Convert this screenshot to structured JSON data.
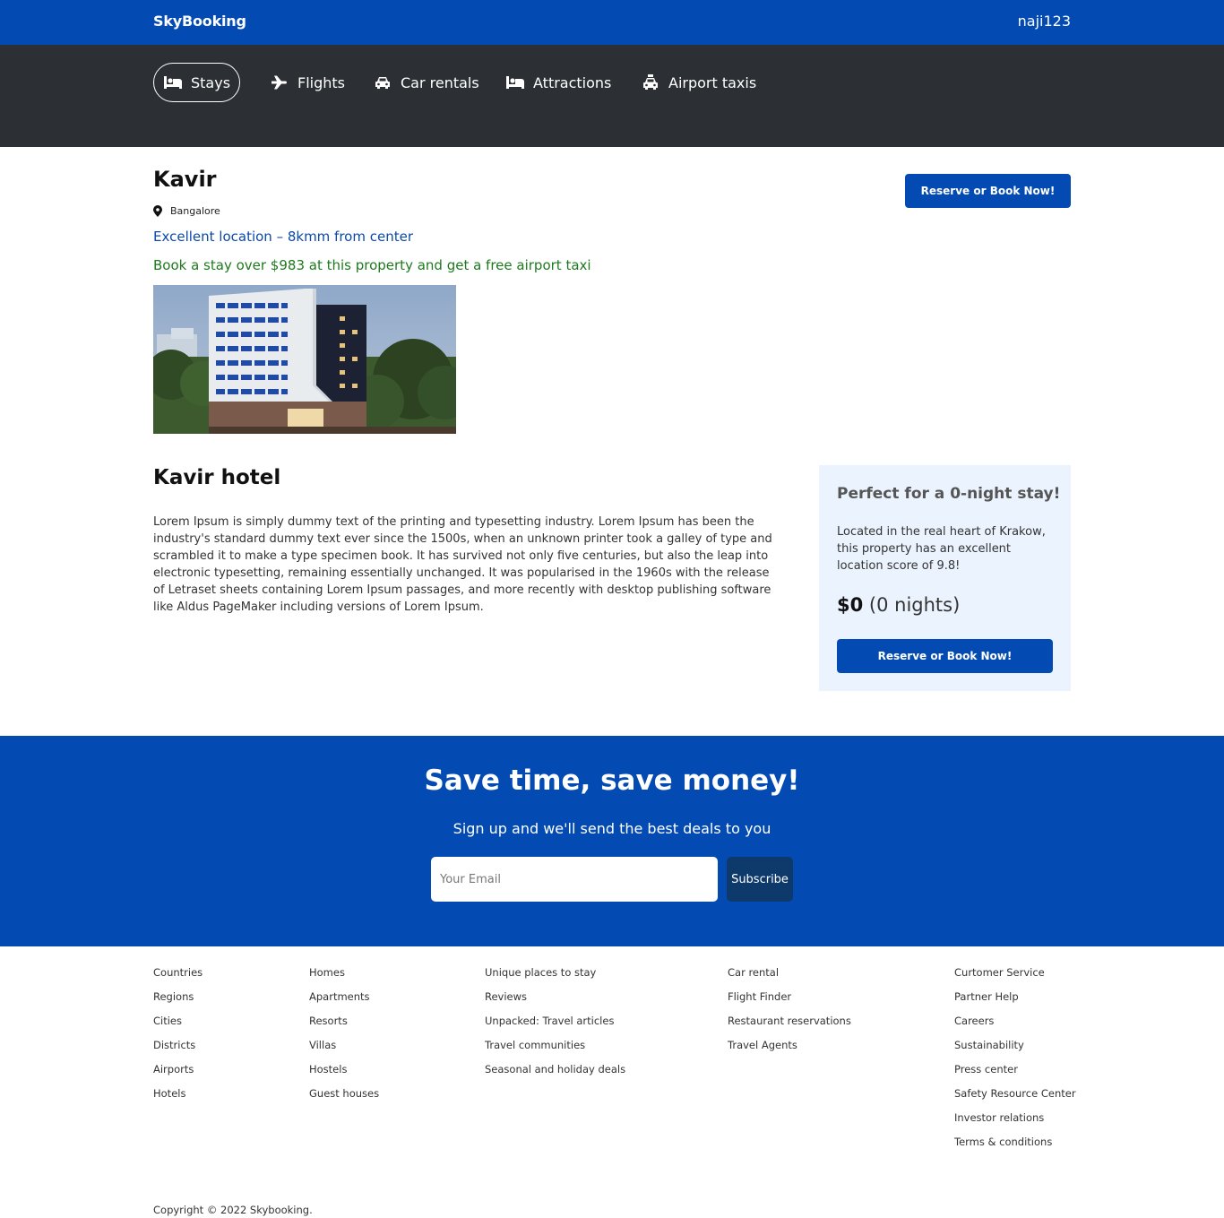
{
  "header": {
    "brand": "SkyBooking",
    "username": "naji123"
  },
  "nav": [
    {
      "label": "Stays",
      "icon": "bed-icon",
      "active": true
    },
    {
      "label": "Flights",
      "icon": "plane-icon",
      "active": false
    },
    {
      "label": "Car rentals",
      "icon": "car-icon",
      "active": false
    },
    {
      "label": "Attractions",
      "icon": "bed-icon",
      "active": false
    },
    {
      "label": "Airport taxis",
      "icon": "taxi-icon",
      "active": false
    }
  ],
  "hotel": {
    "name": "Kavir",
    "city": "Bangalore",
    "location_text": "Excellent location – 8kmm from center",
    "promo": "Book a stay over $983 at this property and get a free airport taxi",
    "reserve_label": "Reserve or Book Now!",
    "desc_title": "Kavir hotel",
    "description": "Lorem Ipsum is simply dummy text of the printing and typesetting industry. Lorem Ipsum has been the industry's standard dummy text ever since the 1500s, when an unknown printer took a galley of type and scrambled it to make a type specimen book. It has survived not only five centuries, but also the leap into electronic typesetting, remaining essentially unchanged. It was popularised in the 1960s with the release of Letraset sheets containing Lorem Ipsum passages, and more recently with desktop publishing software like Aldus PageMaker including versions of Lorem Ipsum."
  },
  "sidebox": {
    "title": "Perfect for a 0-night stay!",
    "text": "Located in the real heart of Krakow, this property has an excellent location score of 9.8!",
    "price": "$0",
    "nights": "(0 nights)",
    "reserve_label": "Reserve or Book Now!"
  },
  "newsletter": {
    "title": "Save time, save money!",
    "subtitle": "Sign up and we'll send the best deals to you",
    "email_placeholder": "Your Email",
    "email_value": "",
    "subscribe_label": "Subscribe"
  },
  "footer": {
    "col1": [
      "Countries",
      "Regions",
      "Cities",
      "Districts",
      "Airports",
      "Hotels"
    ],
    "col2": [
      "Homes",
      "Apartments",
      "Resorts",
      "Villas",
      "Hostels",
      "Guest houses"
    ],
    "col3": [
      "Unique places to stay",
      "Reviews",
      "Unpacked: Travel articles",
      "Travel communities",
      "Seasonal and holiday deals"
    ],
    "col4": [
      "Car rental",
      "Flight Finder",
      "Restaurant reservations",
      "Travel Agents"
    ],
    "col5": [
      "Curtomer Service",
      "Partner Help",
      "Careers",
      "Sustainability",
      "Press center",
      "Safety Resource Center",
      "Investor relations",
      "Terms & conditions"
    ],
    "copyright": "Copyright © 2022 Skybooking."
  },
  "colors": {
    "brand_blue": "#034bb3",
    "nav_dark": "#2c2f33",
    "promo_green": "#1e7a1e",
    "location_blue": "#0b4aa8",
    "sidebox_bg": "#ebf3ff",
    "subscribe_bg": "#0e3a6b"
  }
}
